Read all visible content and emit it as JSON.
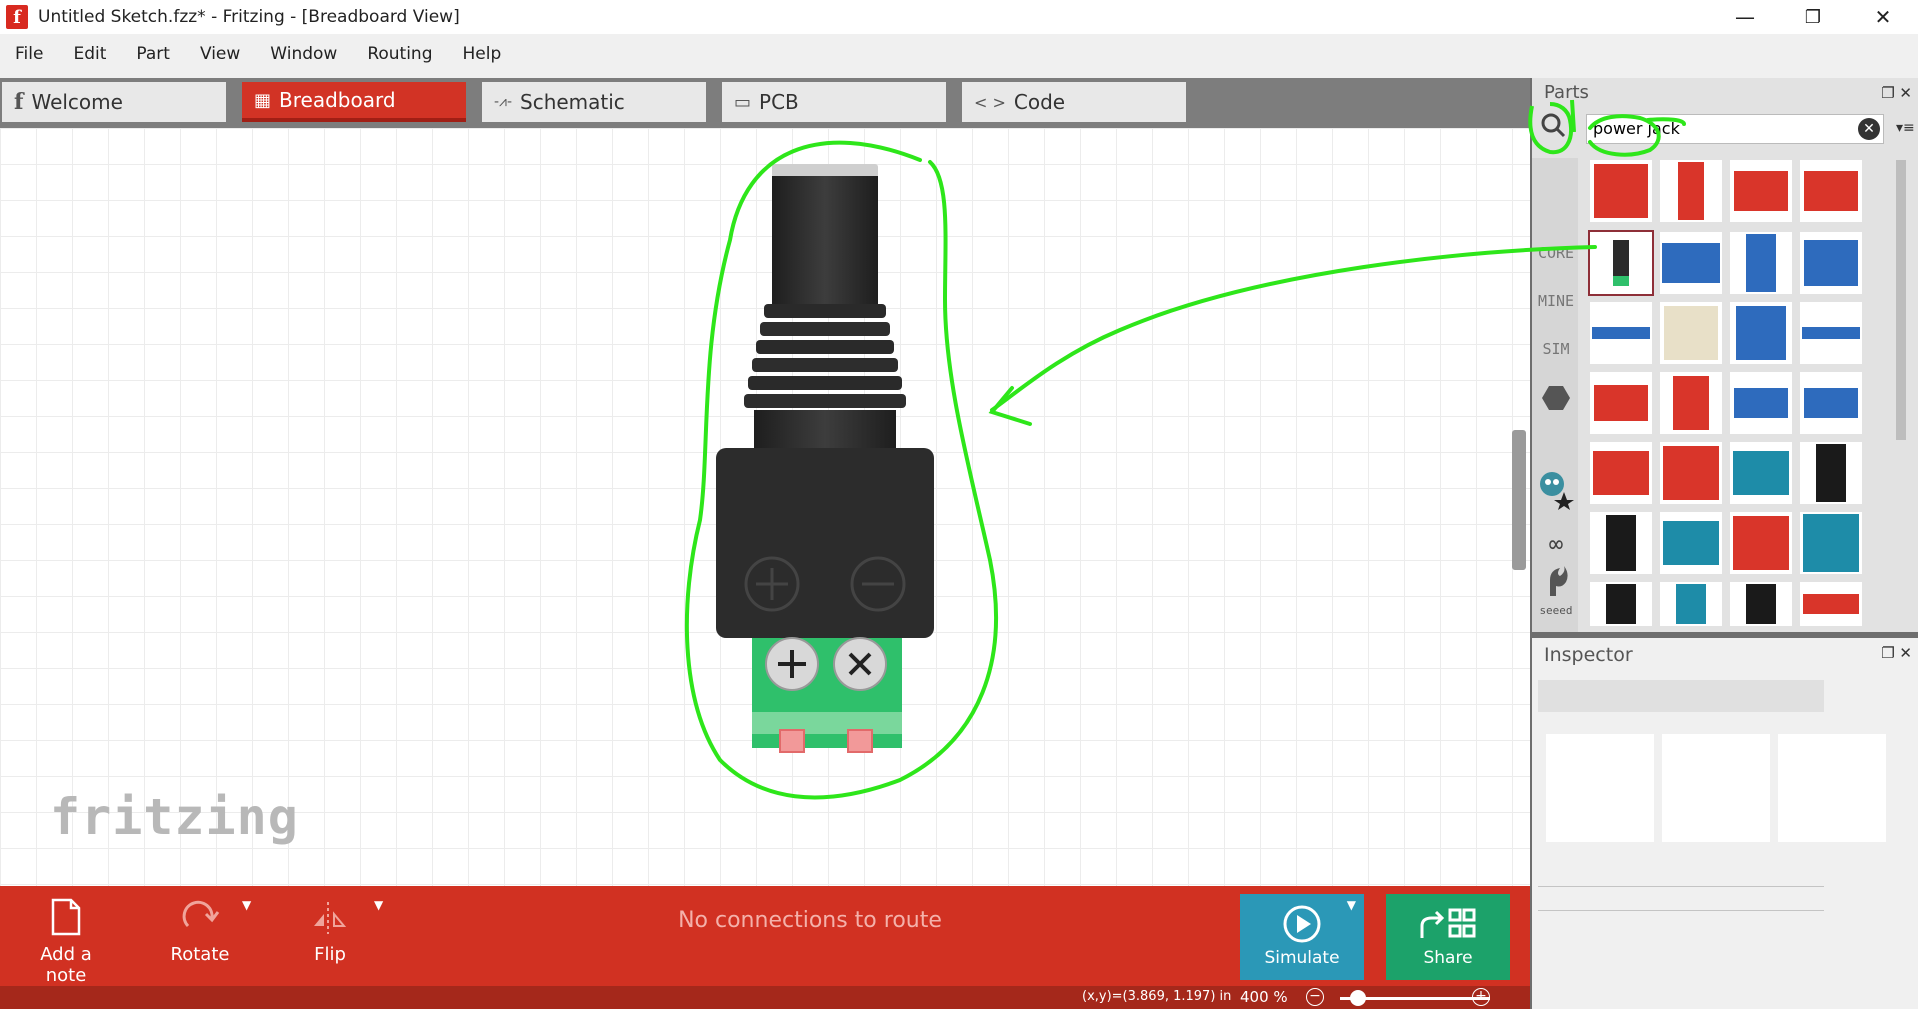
{
  "window": {
    "title": "Untitled Sketch.fzz* - Fritzing - [Breadboard View]",
    "app_icon_glyph": "f",
    "minimize_glyph": "—",
    "maximize_glyph": "❐",
    "close_glyph": "✕"
  },
  "menu": [
    "File",
    "Edit",
    "Part",
    "View",
    "Window",
    "Routing",
    "Help"
  ],
  "tabs": [
    {
      "label": "Welcome",
      "icon": "fritzing-f-icon",
      "glyph": "f",
      "active": false
    },
    {
      "label": "Breadboard",
      "icon": "breadboard-icon",
      "glyph": "▦",
      "active": true
    },
    {
      "label": "Schematic",
      "icon": "resistor-icon",
      "glyph": "-⩘-",
      "active": false
    },
    {
      "label": "PCB",
      "icon": "pcb-icon",
      "glyph": "▭",
      "active": false
    },
    {
      "label": "Code",
      "icon": "code-brackets-icon",
      "glyph": "< >",
      "active": false
    }
  ],
  "canvas": {
    "watermark": "fritzing",
    "part_name_icon": "dc-power-jack-adapter"
  },
  "bottombar": {
    "add_note": "Add a note",
    "rotate": "Rotate",
    "flip": "Flip",
    "status": "No connections to route",
    "simulate": "Simulate",
    "share": "Share"
  },
  "statusbar": {
    "coords": "(x,y)=(3.869, 1.197) in",
    "zoom": "400 %",
    "zoom_out_glyph": "−",
    "zoom_in_glyph": "+",
    "zoom_level": 0.05
  },
  "parts_panel": {
    "title": "Parts",
    "search_value": "power jack",
    "clear_glyph": "✕",
    "menu_glyph": "▾≡",
    "float_glyph": "❐",
    "close_glyph": "✕",
    "bins": [
      "CORE",
      "MINE",
      "SIM"
    ],
    "bin_icons": [
      "hexagon-icon",
      "adafruit-star-icon",
      "arduino-infinity-icon",
      "sparkfun-flame-icon",
      "seeed-icon"
    ],
    "seeed_label": "seeed"
  },
  "inspector": {
    "title": "Inspector",
    "float_glyph": "❐",
    "close_glyph": "✕"
  },
  "colors": {
    "brand_red": "#d23325",
    "simulate_blue": "#2b98b7",
    "share_green": "#1ca26a",
    "annotation_green": "#2ee61a"
  }
}
